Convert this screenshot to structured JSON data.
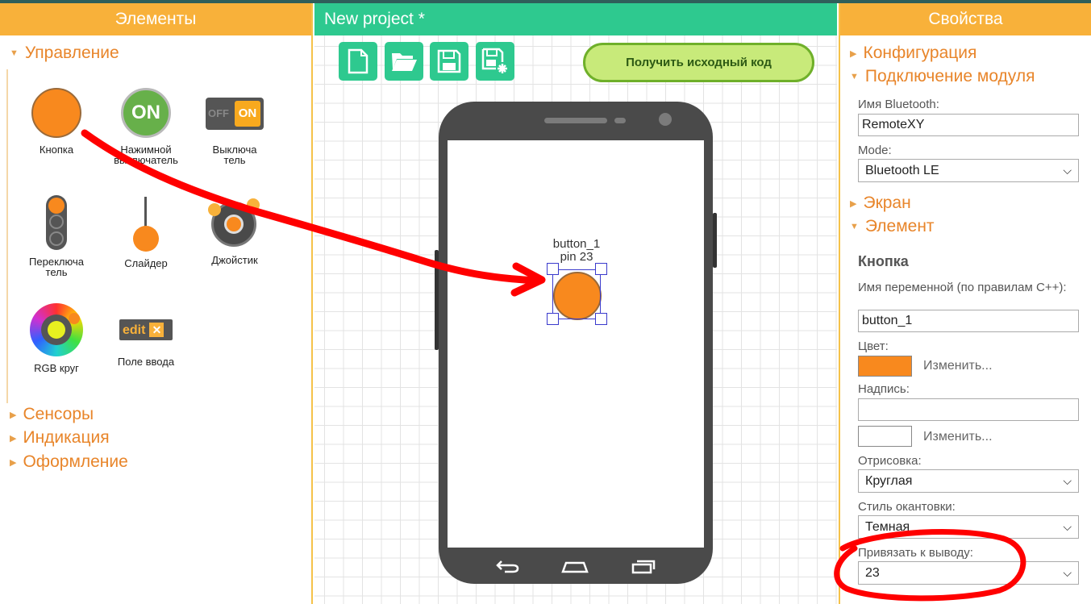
{
  "colors": {
    "panel_header": "#f8b13a",
    "center_header": "#2ec98f",
    "accent_orange": "#e8852a",
    "button_orange": "#f8891e",
    "annotation_red": "#ff0000"
  },
  "left_panel": {
    "header": "Элементы",
    "category_control": "Управление",
    "tools": [
      {
        "label": "Кнопка",
        "icon": "round-button-icon"
      },
      {
        "label": "Нажимной выключатель",
        "icon": "on-button-icon"
      },
      {
        "label": "Выключатель",
        "icon": "off-on-switch-icon"
      },
      {
        "label": "Переключатель",
        "icon": "selector-switch-icon"
      },
      {
        "label": "Слайдер",
        "icon": "slider-icon"
      },
      {
        "label": "Джойстик",
        "icon": "joystick-icon"
      },
      {
        "label": "RGB круг",
        "icon": "rgb-wheel-icon"
      },
      {
        "label": "Поле ввода",
        "icon": "edit-field-icon"
      }
    ],
    "tool_label_lines": {
      "push_switch_1": "Нажимной",
      "push_switch_2": "выключатель",
      "switch_1": "Выключа",
      "switch_2": "тель",
      "selector_1": "Переключа",
      "selector_2": "тель"
    },
    "icon_texts": {
      "on": "ON",
      "off": "OFF",
      "edit": "edit"
    },
    "category_sensors": "Сенсоры",
    "category_indication": "Индикация",
    "category_design": "Оформление"
  },
  "center": {
    "project_title": "New project *",
    "toolbar": {
      "new_icon": "new-file-icon",
      "open_icon": "open-folder-icon",
      "save_icon": "save-icon",
      "save_as_icon": "save-as-icon"
    },
    "get_code_button": "Получить исходный код",
    "element_name": "button_1",
    "element_pin": "pin 23"
  },
  "right_panel": {
    "header": "Свойства",
    "category_config": "Конфигурация",
    "category_module": "Подключение модуля",
    "bluetooth_name_label": "Имя Bluetooth:",
    "bluetooth_name_value": "RemoteXY",
    "mode_label": "Mode:",
    "mode_value": "Bluetooth LE",
    "category_screen": "Экран",
    "category_element": "Элемент",
    "element_title": "Кнопка",
    "var_name_label": "Имя переменной (по правилам C++):",
    "var_name_value": "button_1",
    "color_label": "Цвет:",
    "color_value": "#f8891e",
    "change_link": "Изменить...",
    "caption_label": "Надпись:",
    "caption_value": "",
    "caption_change_link": "Изменить...",
    "render_label": "Отрисовка:",
    "render_value": "Круглая",
    "border_style_label": "Стиль окантовки:",
    "border_style_value": "Темная",
    "pin_label": "Привязать к выводу:",
    "pin_value": "23"
  }
}
